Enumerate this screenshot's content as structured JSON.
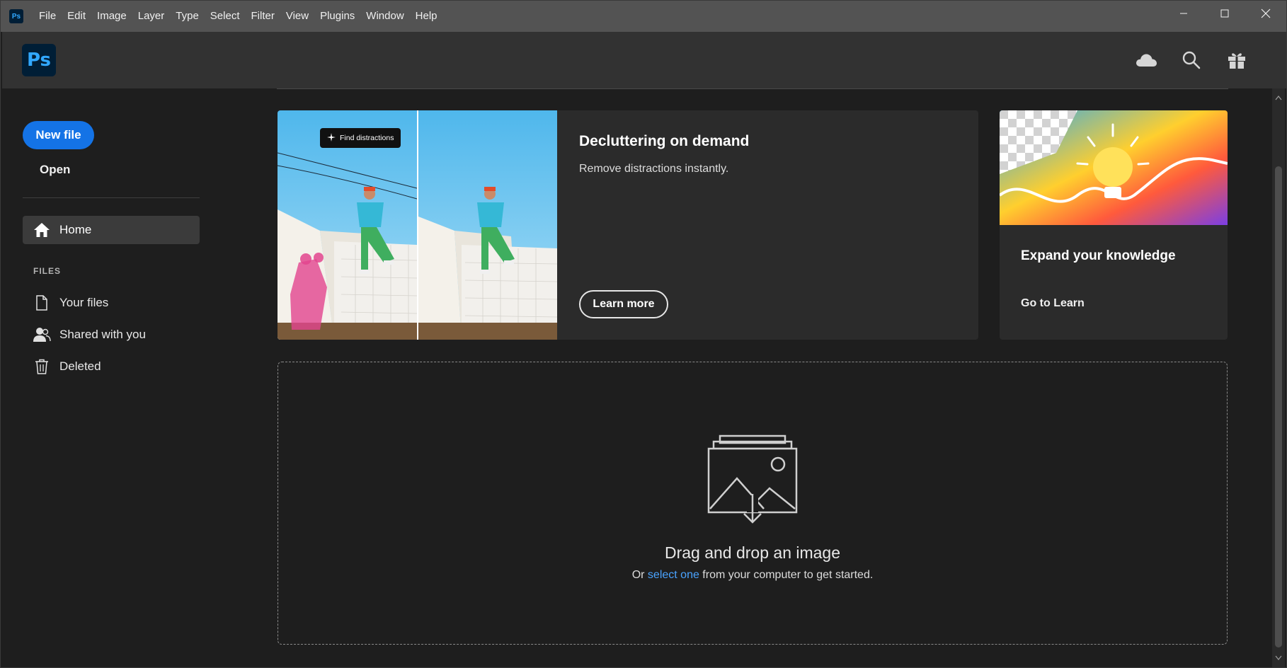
{
  "app": {
    "mini_logo": "Ps",
    "logo": "Ps"
  },
  "menu": [
    "File",
    "Edit",
    "Image",
    "Layer",
    "Type",
    "Select",
    "Filter",
    "View",
    "Plugins",
    "Window",
    "Help"
  ],
  "window_controls": [
    "minimize-icon",
    "maximize-icon",
    "close-icon"
  ],
  "header_icons": [
    "cloud-icon",
    "search-icon",
    "gift-icon"
  ],
  "sidebar": {
    "new_file": "New file",
    "open": "Open",
    "home": "Home",
    "files_heading": "FILES",
    "items": [
      {
        "label": "Your files",
        "icon": "file-icon"
      },
      {
        "label": "Shared with you",
        "icon": "people-icon"
      },
      {
        "label": "Deleted",
        "icon": "trash-icon"
      }
    ]
  },
  "feature": {
    "pill": "Find distractions",
    "title": "Decluttering on demand",
    "subtitle": "Remove distractions instantly.",
    "button": "Learn more"
  },
  "learn": {
    "title": "Expand your knowledge",
    "link": "Go to Learn"
  },
  "dropzone": {
    "title": "Drag and drop an image",
    "sub_before": "Or ",
    "sub_link": "select one",
    "sub_after": " from your computer to get started."
  },
  "colors": {
    "accent": "#1473e6",
    "link": "#4aa3ff",
    "ps_blue": "#31a8ff",
    "ps_bg": "#001e36"
  }
}
